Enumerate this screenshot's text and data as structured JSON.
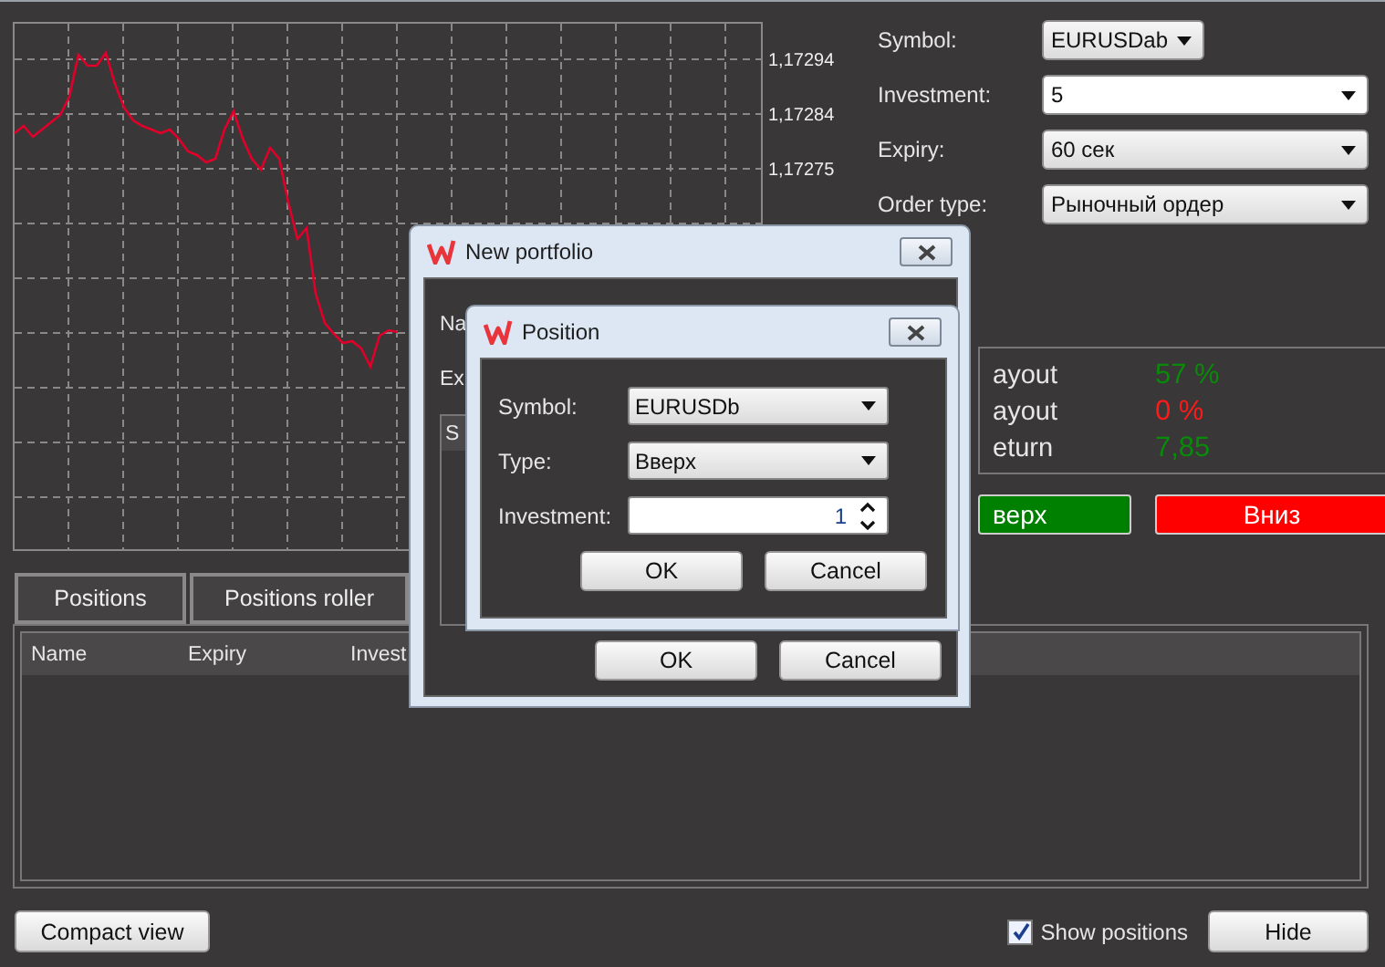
{
  "chart": {
    "price_labels": [
      "1,17294",
      "1,17284",
      "1,17275"
    ]
  },
  "order_form": {
    "fields": [
      {
        "label": "Symbol:",
        "value": "EURUSDab",
        "kind": "short-dropdown"
      },
      {
        "label": "Investment:",
        "value": "5",
        "kind": "combo"
      },
      {
        "label": "Expiry:",
        "value": "60 сек",
        "kind": "dropdown"
      },
      {
        "label": "Order type:",
        "value": "Рыночный ордер",
        "kind": "dropdown"
      }
    ]
  },
  "stats": [
    {
      "label": "ayout",
      "value": "57 %",
      "color": "#0a8a0a"
    },
    {
      "label": "ayout",
      "value": "0 %",
      "color": "#ff1a1a"
    },
    {
      "label": "eturn",
      "value": "7,85",
      "color": "#0a8a0a"
    }
  ],
  "trade_buttons": [
    {
      "label": "верх",
      "color": "#008000"
    },
    {
      "label": "Вниз",
      "color": "#ff0000"
    }
  ],
  "tabs": [
    {
      "label": "Positions",
      "selected": false
    },
    {
      "label": "Positions roller",
      "selected": false
    }
  ],
  "table": {
    "columns": [
      "Name",
      "Expiry",
      "Invest"
    ]
  },
  "footer": {
    "compact_button": "Compact view",
    "show_positions": {
      "label": "Show positions",
      "checked": true
    },
    "hide_button": "Hide"
  },
  "new_portfolio": {
    "title": "New portfolio",
    "name_field": {
      "label": "Na"
    },
    "expiry_field": {
      "label": "Ex"
    },
    "list_header": "S",
    "buttons": [
      "OK",
      "Cancel"
    ]
  },
  "position": {
    "title": "Position",
    "fields": [
      {
        "label": "Symbol:",
        "value": "EURUSDb",
        "kind": "dropdown"
      },
      {
        "label": "Type:",
        "value": "Вверх",
        "kind": "dropdown"
      },
      {
        "label": "Investment:",
        "value": "1",
        "kind": "spinner"
      }
    ],
    "buttons": [
      "OK",
      "Cancel"
    ]
  }
}
